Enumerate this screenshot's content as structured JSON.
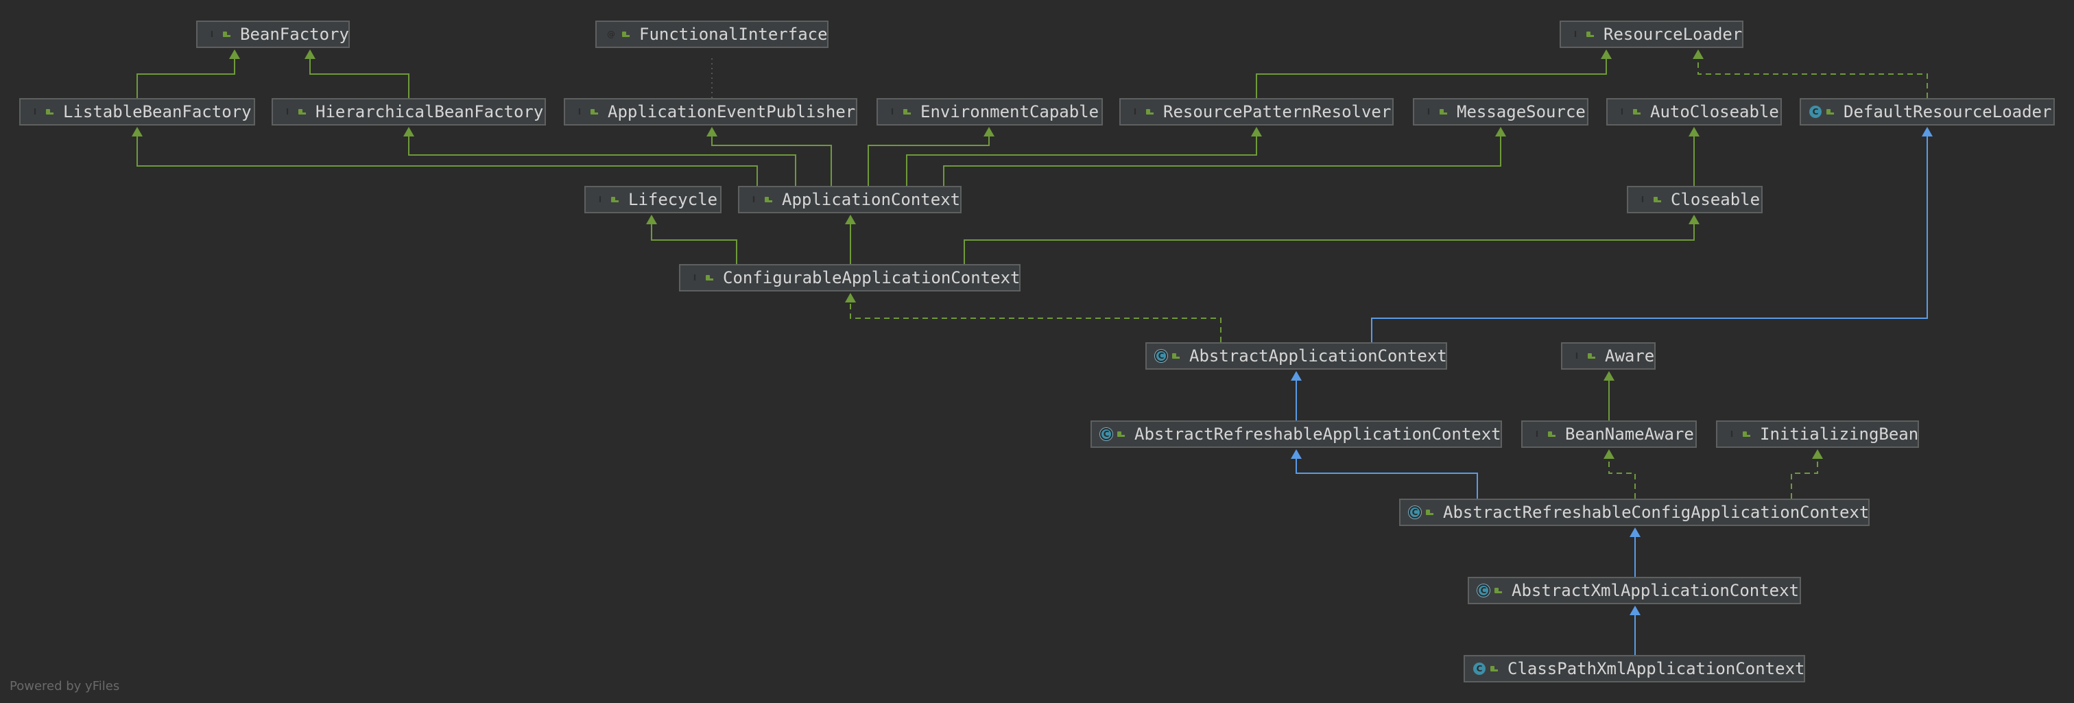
{
  "diagram": {
    "nodes": [
      {
        "id": "BeanFactory",
        "label": "BeanFactory",
        "kind": "interface",
        "icon": "interface-icon"
      },
      {
        "id": "FunctionalInterface",
        "label": "FunctionalInterface",
        "kind": "annotation",
        "icon": "annotation-icon"
      },
      {
        "id": "ResourceLoader",
        "label": "ResourceLoader",
        "kind": "interface",
        "icon": "interface-icon"
      },
      {
        "id": "ListableBeanFactory",
        "label": "ListableBeanFactory",
        "kind": "interface",
        "icon": "interface-icon"
      },
      {
        "id": "HierarchicalBeanFactory",
        "label": "HierarchicalBeanFactory",
        "kind": "interface",
        "icon": "interface-icon"
      },
      {
        "id": "ApplicationEventPublisher",
        "label": "ApplicationEventPublisher",
        "kind": "interface",
        "icon": "interface-icon"
      },
      {
        "id": "EnvironmentCapable",
        "label": "EnvironmentCapable",
        "kind": "interface",
        "icon": "interface-icon"
      },
      {
        "id": "ResourcePatternResolver",
        "label": "ResourcePatternResolver",
        "kind": "interface",
        "icon": "interface-icon"
      },
      {
        "id": "MessageSource",
        "label": "MessageSource",
        "kind": "interface",
        "icon": "interface-icon"
      },
      {
        "id": "AutoCloseable",
        "label": "AutoCloseable",
        "kind": "interface",
        "icon": "interface-icon"
      },
      {
        "id": "DefaultResourceLoader",
        "label": "DefaultResourceLoader",
        "kind": "class",
        "icon": "class-icon"
      },
      {
        "id": "Lifecycle",
        "label": "Lifecycle",
        "kind": "interface",
        "icon": "interface-icon"
      },
      {
        "id": "ApplicationContext",
        "label": "ApplicationContext",
        "kind": "interface",
        "icon": "interface-icon"
      },
      {
        "id": "Closeable",
        "label": "Closeable",
        "kind": "interface",
        "icon": "interface-icon"
      },
      {
        "id": "ConfigurableApplicationContext",
        "label": "ConfigurableApplicationContext",
        "kind": "interface",
        "icon": "interface-icon"
      },
      {
        "id": "AbstractApplicationContext",
        "label": "AbstractApplicationContext",
        "kind": "abstract",
        "icon": "abstract-class-icon"
      },
      {
        "id": "Aware",
        "label": "Aware",
        "kind": "interface",
        "icon": "interface-icon"
      },
      {
        "id": "AbstractRefreshableApplicationContext",
        "label": "AbstractRefreshableApplicationContext",
        "kind": "abstract",
        "icon": "abstract-class-icon"
      },
      {
        "id": "BeanNameAware",
        "label": "BeanNameAware",
        "kind": "interface",
        "icon": "interface-icon"
      },
      {
        "id": "InitializingBean",
        "label": "InitializingBean",
        "kind": "interface",
        "icon": "interface-icon"
      },
      {
        "id": "AbstractRefreshableConfigApplicationContext",
        "label": "AbstractRefreshableConfigApplicationContext",
        "kind": "abstract",
        "icon": "abstract-class-icon"
      },
      {
        "id": "AbstractXmlApplicationContext",
        "label": "AbstractXmlApplicationContext",
        "kind": "abstract",
        "icon": "abstract-class-icon"
      },
      {
        "id": "ClassPathXmlApplicationContext",
        "label": "ClassPathXmlApplicationContext",
        "kind": "class",
        "icon": "class-icon"
      }
    ],
    "edges": [
      {
        "from": "ListableBeanFactory",
        "to": "BeanFactory",
        "type": "extends"
      },
      {
        "from": "HierarchicalBeanFactory",
        "to": "BeanFactory",
        "type": "extends"
      },
      {
        "from": "ApplicationEventPublisher",
        "to": "FunctionalInterface",
        "type": "annotated"
      },
      {
        "from": "ResourcePatternResolver",
        "to": "ResourceLoader",
        "type": "extends"
      },
      {
        "from": "DefaultResourceLoader",
        "to": "ResourceLoader",
        "type": "implements"
      },
      {
        "from": "ApplicationContext",
        "to": "ListableBeanFactory",
        "type": "extends"
      },
      {
        "from": "ApplicationContext",
        "to": "HierarchicalBeanFactory",
        "type": "extends"
      },
      {
        "from": "ApplicationContext",
        "to": "ApplicationEventPublisher",
        "type": "extends"
      },
      {
        "from": "ApplicationContext",
        "to": "EnvironmentCapable",
        "type": "extends"
      },
      {
        "from": "ApplicationContext",
        "to": "ResourcePatternResolver",
        "type": "extends"
      },
      {
        "from": "ApplicationContext",
        "to": "MessageSource",
        "type": "extends"
      },
      {
        "from": "Closeable",
        "to": "AutoCloseable",
        "type": "extends"
      },
      {
        "from": "ConfigurableApplicationContext",
        "to": "Lifecycle",
        "type": "extends"
      },
      {
        "from": "ConfigurableApplicationContext",
        "to": "ApplicationContext",
        "type": "extends"
      },
      {
        "from": "ConfigurableApplicationContext",
        "to": "Closeable",
        "type": "extends"
      },
      {
        "from": "AbstractApplicationContext",
        "to": "ConfigurableApplicationContext",
        "type": "implements"
      },
      {
        "from": "AbstractApplicationContext",
        "to": "DefaultResourceLoader",
        "type": "class-extends"
      },
      {
        "from": "AbstractRefreshableApplicationContext",
        "to": "AbstractApplicationContext",
        "type": "class-extends"
      },
      {
        "from": "BeanNameAware",
        "to": "Aware",
        "type": "extends"
      },
      {
        "from": "AbstractRefreshableConfigApplicationContext",
        "to": "AbstractRefreshableApplicationContext",
        "type": "class-extends"
      },
      {
        "from": "AbstractRefreshableConfigApplicationContext",
        "to": "BeanNameAware",
        "type": "implements"
      },
      {
        "from": "AbstractRefreshableConfigApplicationContext",
        "to": "InitializingBean",
        "type": "implements"
      },
      {
        "from": "AbstractXmlApplicationContext",
        "to": "AbstractRefreshableConfigApplicationContext",
        "type": "class-extends"
      },
      {
        "from": "ClassPathXmlApplicationContext",
        "to": "AbstractXmlApplicationContext",
        "type": "class-extends"
      }
    ],
    "colors": {
      "background": "#2b2b2b",
      "node_fill": "#3c3f41",
      "node_border": "#5e6060",
      "text": "#d6d6d6",
      "interface_edge": "#6e9a3a",
      "class_edge": "#5a9be6",
      "annotation_edge": "#555555"
    }
  },
  "footer": {
    "watermark": "Powered by yFiles"
  }
}
